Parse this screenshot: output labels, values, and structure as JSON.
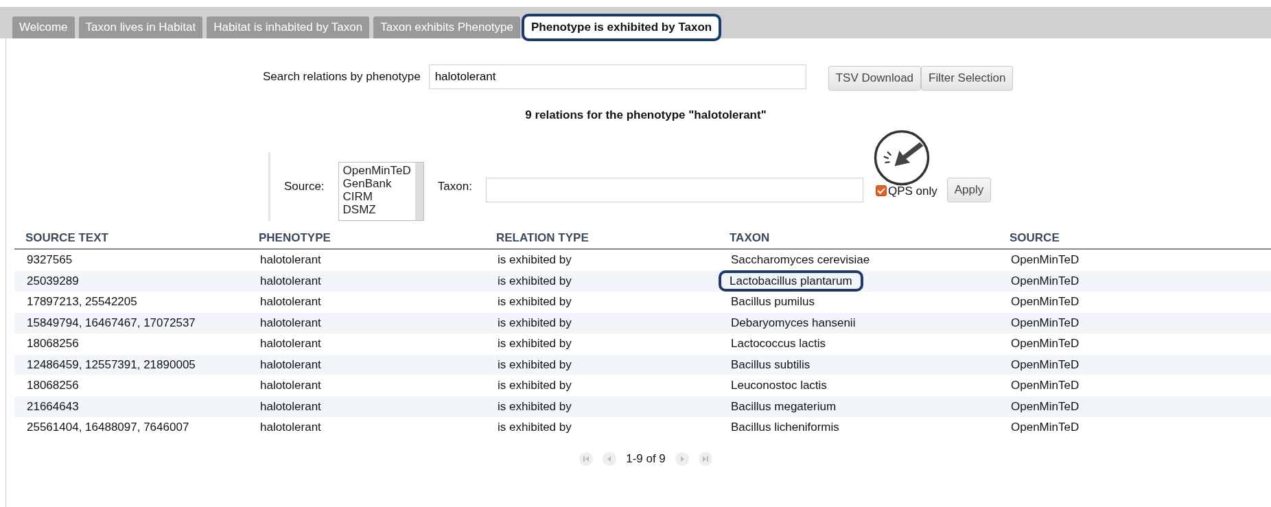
{
  "tabs": [
    {
      "label": "Welcome",
      "selected": false,
      "highlighted": false
    },
    {
      "label": "Taxon lives in Habitat",
      "selected": false,
      "highlighted": false
    },
    {
      "label": "Habitat is inhabited by Taxon",
      "selected": false,
      "highlighted": false
    },
    {
      "label": "Taxon exhibits Phenotype",
      "selected": false,
      "highlighted": false
    },
    {
      "label": "Phenotype is exhibited by Taxon",
      "selected": true,
      "highlighted": true
    }
  ],
  "search": {
    "label": "Search relations by phenotype",
    "value": "halotolerant"
  },
  "buttons": [
    "TSV Download",
    "Filter Selection"
  ],
  "summary": "9 relations for the phenotype \"halotolerant\"",
  "filter": {
    "source_label": "Source:",
    "sources": [
      "OpenMinTeD",
      "GenBank",
      "CIRM",
      "DSMZ"
    ],
    "taxon_label": "Taxon:",
    "qps": {
      "label": "QPS only",
      "checked": true
    },
    "apply": "Apply"
  },
  "table": {
    "columns": [
      "SOURCE TEXT",
      "PHENOTYPE",
      "RELATION TYPE",
      "TAXON",
      "SOURCE"
    ],
    "rows": [
      {
        "cells": [
          "9327565",
          "halotolerant",
          "is exhibited by",
          "Saccharomyces cerevisiae",
          "OpenMinTeD"
        ],
        "taxon_highlighted": false
      },
      {
        "cells": [
          "25039289",
          "halotolerant",
          "is exhibited by",
          "Lactobacillus plantarum",
          "OpenMinTeD"
        ],
        "taxon_highlighted": true
      },
      {
        "cells": [
          "17897213, 25542205",
          "halotolerant",
          "is exhibited by",
          "Bacillus pumilus",
          "OpenMinTeD"
        ],
        "taxon_highlighted": false
      },
      {
        "cells": [
          "15849794, 16467467, 17072537",
          "halotolerant",
          "is exhibited by",
          "Debaryomyces hansenii",
          "OpenMinTeD"
        ],
        "taxon_highlighted": false
      },
      {
        "cells": [
          "18068256",
          "halotolerant",
          "is exhibited by",
          "Lactococcus lactis",
          "OpenMinTeD"
        ],
        "taxon_highlighted": false
      },
      {
        "cells": [
          "12486459, 12557391, 21890005",
          "halotolerant",
          "is exhibited by",
          "Bacillus subtilis",
          "OpenMinTeD"
        ],
        "taxon_highlighted": false
      },
      {
        "cells": [
          "18068256",
          "halotolerant",
          "is exhibited by",
          "Leuconostoc lactis",
          "OpenMinTeD"
        ],
        "taxon_highlighted": false
      },
      {
        "cells": [
          "21664643",
          "halotolerant",
          "is exhibited by",
          "Bacillus megaterium",
          "OpenMinTeD"
        ],
        "taxon_highlighted": false
      },
      {
        "cells": [
          "25561404, 16488097, 7646007",
          "halotolerant",
          "is exhibited by",
          "Bacillus licheniformis",
          "OpenMinTeD"
        ],
        "taxon_highlighted": false
      }
    ]
  },
  "pagination": "1-9 of 9"
}
